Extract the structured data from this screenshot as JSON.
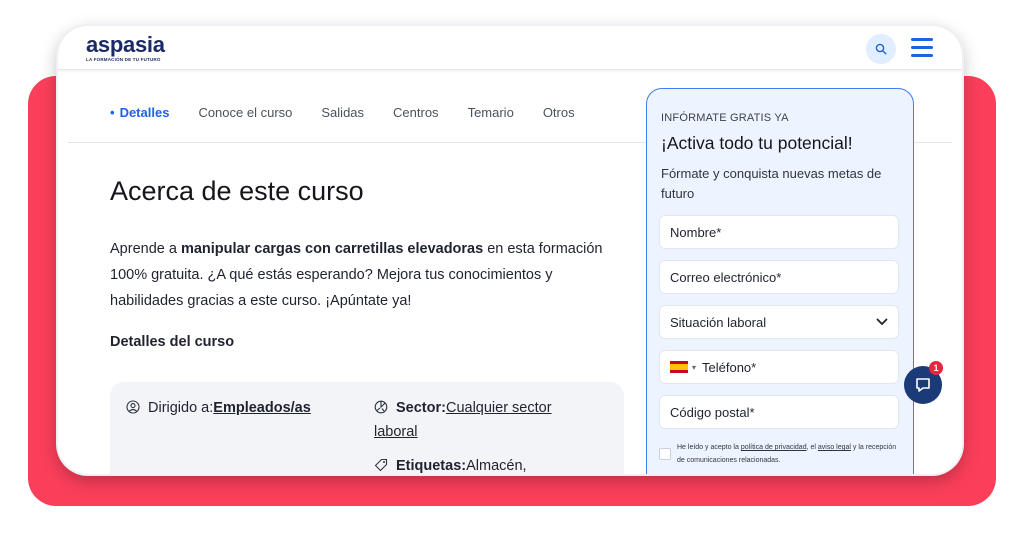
{
  "brand": {
    "name": "aspasia",
    "tagline": "LA FORMACIÓN DE TU FUTURO"
  },
  "colors": {
    "accent": "#1f63e0",
    "backdrop": "#fb3f5b",
    "navy": "#1b2a67"
  },
  "nav": {
    "tabs": [
      "Detalles",
      "Conoce el curso",
      "Salidas",
      "Centros",
      "Temario",
      "Otros"
    ],
    "active": "Detalles"
  },
  "main": {
    "heading": "Acerca de este curso",
    "intro_pre": "Aprende a ",
    "intro_bold": "manipular cargas con carretillas elevadoras",
    "intro_post": " en esta formación 100% gratuita. ¿A qué estás esperando? Mejora tus conocimientos y habilidades gracias a este curso. ¡Apúntate ya!",
    "details_title": "Detalles del curso",
    "details": {
      "dirigido_label": "Dirigido a:",
      "dirigido_value": "Empleados/as",
      "sector_label": "Sector:",
      "sector_value": "Cualquier sector laboral",
      "etiquetas_label": "Etiquetas:",
      "etiquetas_value": "Almacén,"
    }
  },
  "form": {
    "eyebrow": "INFÓRMATE GRATIS YA",
    "title": "¡Activa todo tu potencial!",
    "subtitle": "Fórmate y conquista nuevas metas de futuro",
    "name_placeholder": "Nombre*",
    "email_placeholder": "Correo electrónico*",
    "situacion_placeholder": "Situación laboral",
    "phone_placeholder": "Teléfono*",
    "postal_placeholder": "Código postal*",
    "consent_pre": "He leído y acepto la ",
    "consent_link1": "política de privacidad",
    "consent_mid": ", el ",
    "consent_link2": "aviso legal",
    "consent_post": " y la recepción de comunicaciones relacionadas."
  },
  "chat": {
    "badge": "1"
  },
  "icons": [
    "search-icon",
    "menu-icon",
    "user-circle-icon",
    "sector-icon",
    "tag-icon",
    "chevron-down-icon",
    "spain-flag-icon",
    "chat-icon"
  ]
}
